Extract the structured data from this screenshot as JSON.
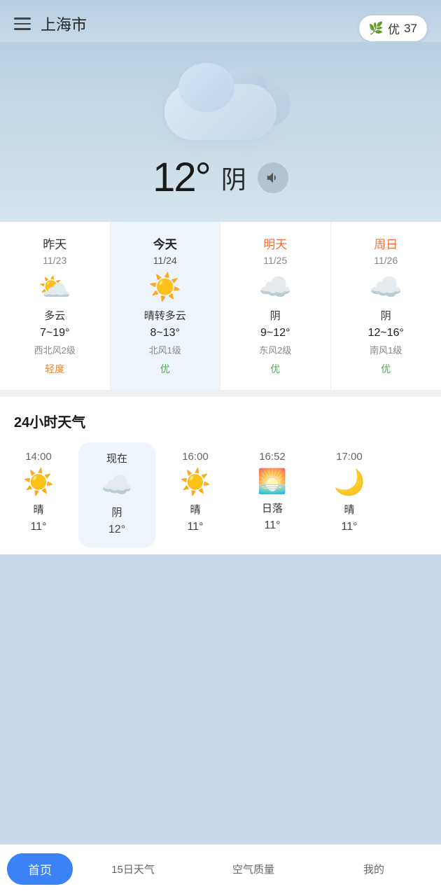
{
  "header": {
    "city": "上海市",
    "menu_label": "menu"
  },
  "aqi": {
    "level": "优",
    "value": "37"
  },
  "hero": {
    "temperature": "12°",
    "weather": "阴",
    "sound_button": "sound"
  },
  "forecast": {
    "days": [
      {
        "day": "昨天",
        "day_type": "yesterday",
        "date": "11/23",
        "weather_icon": "⛅",
        "weather_text": "多云",
        "temp_range": "7~19°",
        "wind": "西北风2级",
        "aqi": "轻度",
        "aqi_type": "mild"
      },
      {
        "day": "今天",
        "day_type": "today",
        "date": "11/24",
        "weather_icon": "☀️",
        "weather_text": "晴转多云",
        "temp_range": "8~13°",
        "wind": "北风1级",
        "aqi": "优",
        "aqi_type": "good"
      },
      {
        "day": "明天",
        "day_type": "tomorrow",
        "date": "11/25",
        "weather_icon": "☁️",
        "weather_text": "阴",
        "temp_range": "9~12°",
        "wind": "东风2级",
        "aqi": "优",
        "aqi_type": "good"
      },
      {
        "day": "周日",
        "day_type": "sunday",
        "date": "11/26",
        "weather_icon": "☁️",
        "weather_text": "阴",
        "temp_range": "12~16°",
        "wind": "南风1级",
        "aqi": "优",
        "aqi_type": "good"
      }
    ]
  },
  "hourly_section": {
    "title": "24小时天气",
    "hours": [
      {
        "label": "14:00",
        "label_type": "normal",
        "icon": "☀️",
        "desc": "晴",
        "temp": "11°"
      },
      {
        "label": "现在",
        "label_type": "now",
        "icon": "☁️",
        "desc": "阴",
        "temp": "12°",
        "active": true
      },
      {
        "label": "16:00",
        "label_type": "normal",
        "icon": "☀️",
        "desc": "晴",
        "temp": "11°"
      },
      {
        "label": "16:52",
        "label_type": "normal",
        "icon": "🌅",
        "desc": "日落",
        "temp": "11°"
      },
      {
        "label": "17:00",
        "label_type": "normal",
        "icon": "🌙",
        "desc": "晴",
        "temp": "11°"
      }
    ]
  },
  "nav": {
    "items": [
      {
        "label": "首页",
        "active": true
      },
      {
        "label": "15日天气",
        "active": false
      },
      {
        "label": "空气质量",
        "active": false
      },
      {
        "label": "我的",
        "active": false
      }
    ]
  }
}
